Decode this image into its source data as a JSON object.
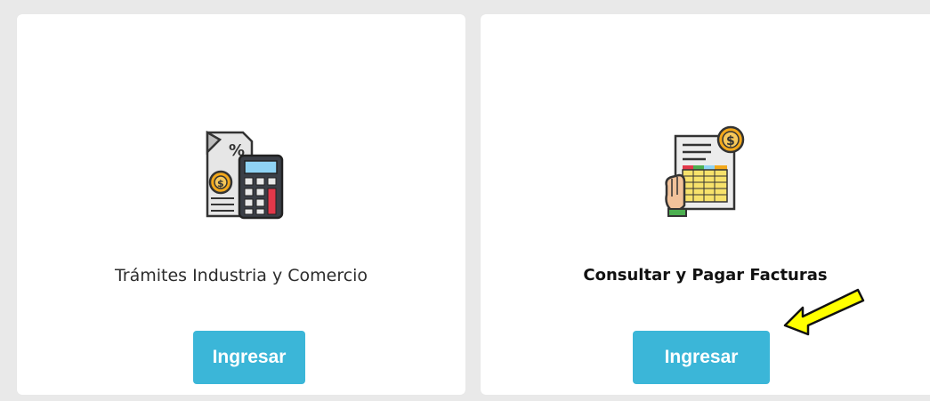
{
  "cards": [
    {
      "icon": "tax-calculator-icon",
      "title": "Trámites Industria y Comercio",
      "button_label": "Ingresar"
    },
    {
      "icon": "invoice-payment-icon",
      "title": "Consultar y Pagar Facturas",
      "button_label": "Ingresar"
    }
  ],
  "annotation": {
    "icon": "yellow-arrow-icon",
    "color": "#ffff00"
  },
  "colors": {
    "button": "#3bb6d8",
    "page_background": "#e9e9e9",
    "card_background": "#ffffff"
  }
}
